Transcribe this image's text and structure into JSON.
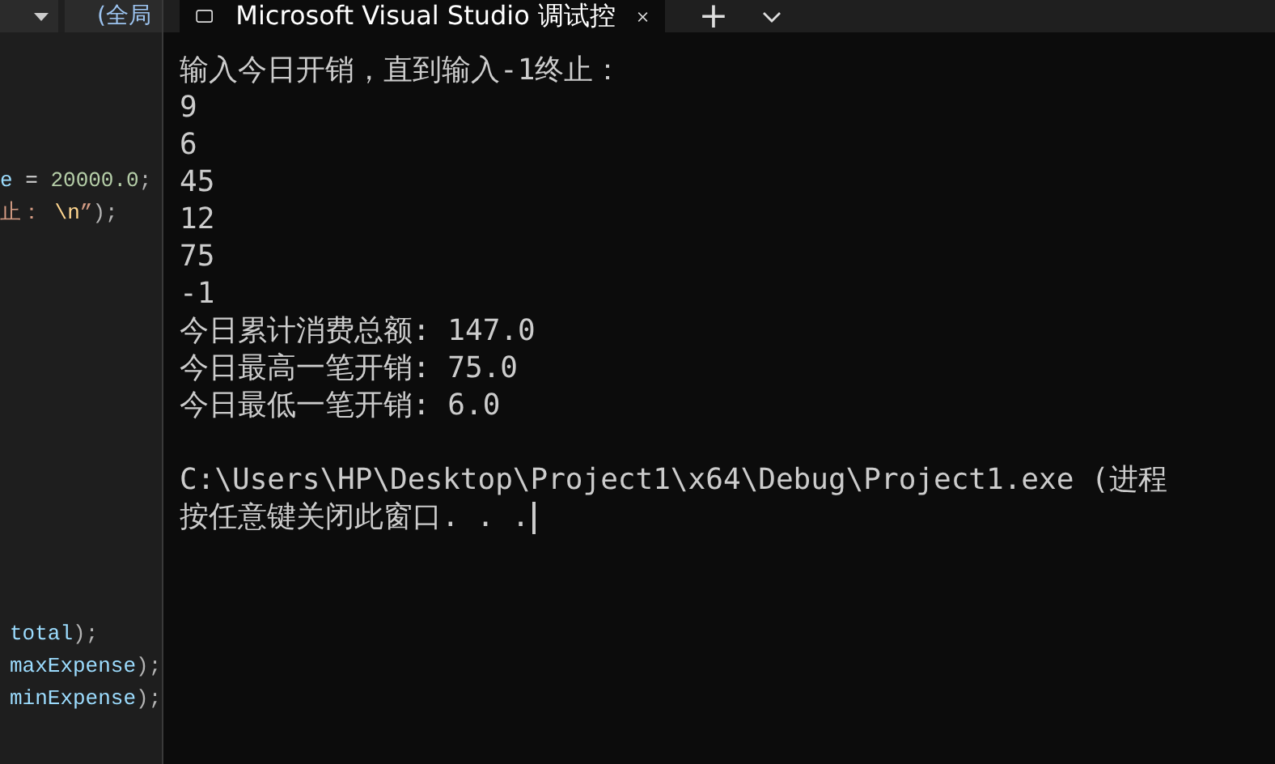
{
  "editor": {
    "toolbar": {
      "dropdowns": [
        {
          "label": "(全局"
        }
      ]
    },
    "top_lines": [
      [
        {
          "kind": "identifier",
          "text": "e"
        },
        {
          "kind": "plain",
          "text": " = "
        },
        {
          "kind": "number",
          "text": "20000.0"
        },
        {
          "kind": "punct",
          "text": ";"
        }
      ],
      [
        {
          "kind": "string",
          "text": "止："
        },
        {
          "kind": "escape",
          "text": " \\n"
        },
        {
          "kind": "string",
          "text": "”"
        },
        {
          "kind": "punct",
          "text": ");"
        }
      ]
    ],
    "bottom_lines": [
      [
        {
          "kind": "identifier",
          "text": "total"
        },
        {
          "kind": "punct",
          "text": ");"
        }
      ],
      [
        {
          "kind": "identifier",
          "text": "maxExpense"
        },
        {
          "kind": "punct",
          "text": ");"
        }
      ],
      [
        {
          "kind": "identifier",
          "text": "minExpense"
        },
        {
          "kind": "punct",
          "text": ");"
        }
      ]
    ]
  },
  "terminal": {
    "tabs": [
      {
        "title": "Microsoft Visual Studio 调试控",
        "selected": true
      }
    ],
    "new_tab": "+",
    "lines": [
      "输入今日开销，直到输入-1终止：",
      "9",
      "6",
      "45",
      "12",
      "75",
      "-1",
      "今日累计消费总额: 147.0",
      "今日最高一笔开销: 75.0",
      "今日最低一笔开销: 6.0"
    ],
    "footer_lines": [
      "C:\\Users\\HP\\Desktop\\Project1\\x64\\Debug\\Project1.exe (进程",
      "按任意键关闭此窗口. . ."
    ],
    "cursor": true
  }
}
